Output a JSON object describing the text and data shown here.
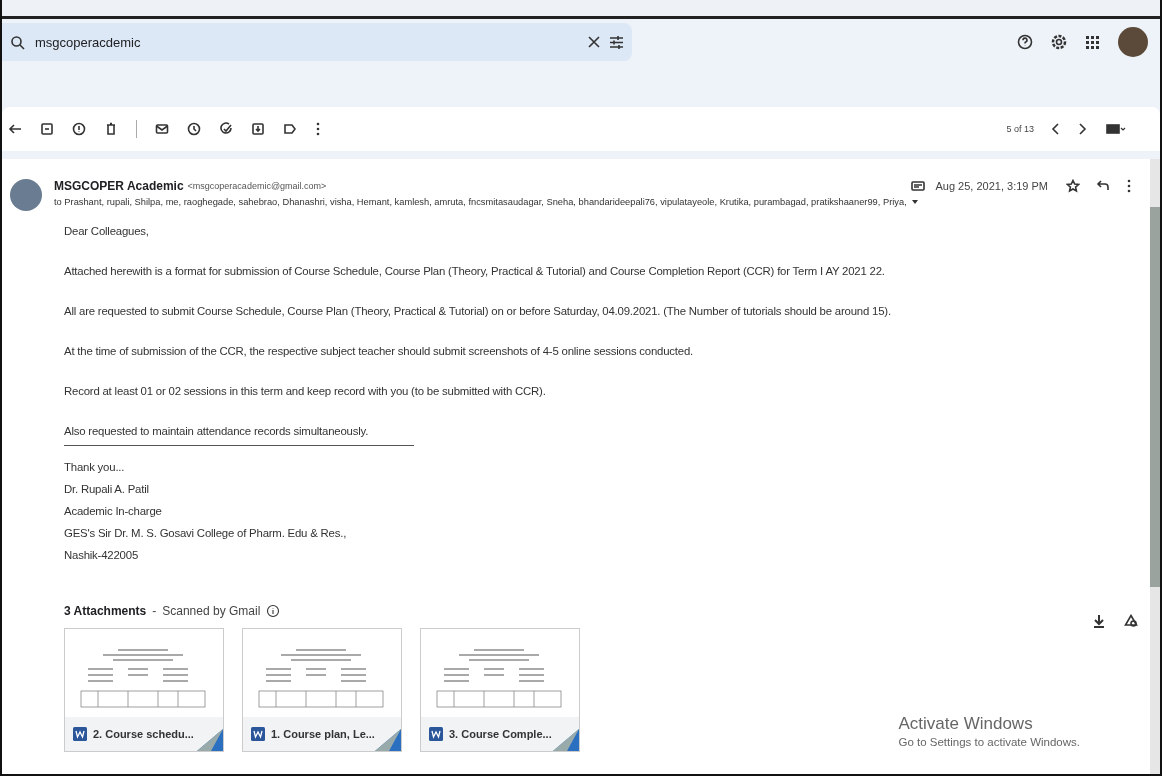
{
  "search": {
    "value": "msgcoperacdemic"
  },
  "pager": "5 of 13",
  "message": {
    "sender_name": "MSGCOPER Academic",
    "sender_email": "<msgcoperacademic@gmail.com>",
    "date": "Aug 25, 2021, 3:19 PM",
    "recipients": "to Prashant, rupali, Shilpa, me, raoghegade, sahebrao, Dhanashri, visha, Hemant, kamlesh, amruta, fncsmitasaudagar, Sneha, bhandarideepali76, vipulatayeole, Krutika, purambagad, pratikshaaner99, Priya,",
    "greeting": "Dear Colleagues,",
    "paragraphs": [
      "Attached herewith is a format for submission of Course Schedule, Course Plan (Theory, Practical & Tutorial) and Course Completion Report (CCR) for Term I  AY 2021 22.",
      "All are requested to submit  Course Schedule, Course Plan (Theory, Practical & Tutorial) on or before Saturday, 04.09.2021. (The Number of tutorials should be around 15).",
      "At the time of submission of the CCR, the respective subject teacher should submit screenshots of 4-5 online sessions conducted.",
      "Record at least 01 or 02 sessions in this term and keep record with you (to be submitted with CCR).",
      "Also requested to maintain attendance records simultaneously."
    ],
    "signature": [
      "Thank you...",
      "Dr. Rupali A. Patil",
      "Academic In-charge",
      "GES's Sir Dr. M. S. Gosavi College of Pharm. Edu & Res.,",
      "Nashik-422005"
    ]
  },
  "attachments": {
    "heading": "3 Attachments",
    "separator": "-",
    "note": "Scanned by Gmail",
    "files": [
      {
        "name": "2. Course schedu..."
      },
      {
        "name": "1. Course plan, Le..."
      },
      {
        "name": "3. Course Comple..."
      }
    ]
  },
  "activation": {
    "title": "Activate Windows",
    "subtitle": "Go to Settings to activate Windows."
  }
}
